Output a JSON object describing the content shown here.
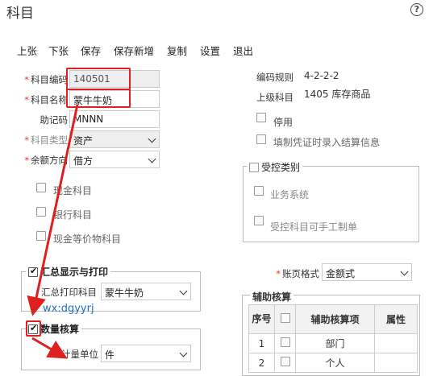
{
  "window": {
    "title": "科目",
    "help_icon": "help-icon",
    "help_glyph": "?"
  },
  "toolbar": [
    "上张",
    "下张",
    "保存",
    "保存新增",
    "复制",
    "设置",
    "退出"
  ],
  "form": {
    "code_label": "科目编码",
    "code_value": "140501",
    "name_label": "科目名称",
    "name_value": "蒙牛牛奶",
    "mnemonic_label": "助记码",
    "mnemonic_value": "MNNN",
    "type_label": "科目类型",
    "type_value": "资产",
    "balance_label": "余额方向",
    "balance_value": "借方",
    "cash_label": "现金科目",
    "bank_label": "银行科目",
    "equiv_label": "现金等价物科目"
  },
  "right": {
    "rule_label": "编码规则",
    "rule_value": "4-2-2-2",
    "parent_label": "上级科目",
    "parent_value": "1405 库存商品",
    "disabled_label": "停用",
    "settle_label": "填制凭证时录入结算信息"
  },
  "controlled": {
    "legend": "受控类别",
    "business_label": "业务系统",
    "manual_label": "受控科目可手工制单"
  },
  "summary": {
    "legend": "汇总显示与打印",
    "print_label": "汇总打印科目",
    "print_value": "蒙牛牛奶",
    "watermark": "wx:dgyyrj"
  },
  "quantity": {
    "legend": "数量核算",
    "unit_label": "计量单位",
    "unit_value": "件"
  },
  "ledger": {
    "label": "账页格式",
    "value": "金额式"
  },
  "aux": {
    "title": "辅助核算",
    "headers": [
      "序号",
      "辅助核算项",
      "属性"
    ],
    "rows": [
      {
        "no": "1",
        "item": "部门"
      },
      {
        "no": "2",
        "item": "个人"
      }
    ]
  },
  "colors": {
    "annotation": "#e02020",
    "watermark": "#1a73c9"
  }
}
